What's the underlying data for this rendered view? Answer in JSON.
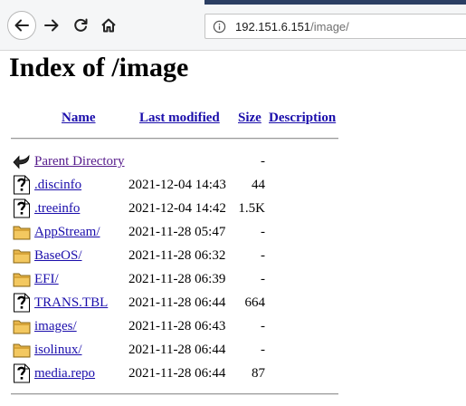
{
  "browser": {
    "url_host": "192.151.6.151",
    "url_path": "/image/"
  },
  "page": {
    "title": "Index of /image"
  },
  "columns": {
    "name": "Name",
    "last_modified": "Last modified",
    "size": "Size",
    "description": "Description"
  },
  "rows": [
    {
      "name": "Parent Directory",
      "date": "",
      "size": "-",
      "icon": "back-arrow-icon"
    },
    {
      "name": ".discinfo",
      "date": "2021-12-04 14:43",
      "size": "44",
      "icon": "unknown-file-icon"
    },
    {
      "name": ".treeinfo",
      "date": "2021-12-04 14:42",
      "size": "1.5K",
      "icon": "unknown-file-icon"
    },
    {
      "name": "AppStream/",
      "date": "2021-11-28 05:47",
      "size": "-",
      "icon": "folder-icon"
    },
    {
      "name": "BaseOS/",
      "date": "2021-11-28 06:32",
      "size": "-",
      "icon": "folder-icon"
    },
    {
      "name": "EFI/",
      "date": "2021-11-28 06:39",
      "size": "-",
      "icon": "folder-icon"
    },
    {
      "name": "TRANS.TBL",
      "date": "2021-11-28 06:44",
      "size": "664",
      "icon": "unknown-file-icon"
    },
    {
      "name": "images/",
      "date": "2021-11-28 06:43",
      "size": "-",
      "icon": "folder-icon"
    },
    {
      "name": "isolinux/",
      "date": "2021-11-28 06:44",
      "size": "-",
      "icon": "folder-icon"
    },
    {
      "name": "media.repo",
      "date": "2021-11-28 06:44",
      "size": "87",
      "icon": "unknown-file-icon"
    }
  ]
}
